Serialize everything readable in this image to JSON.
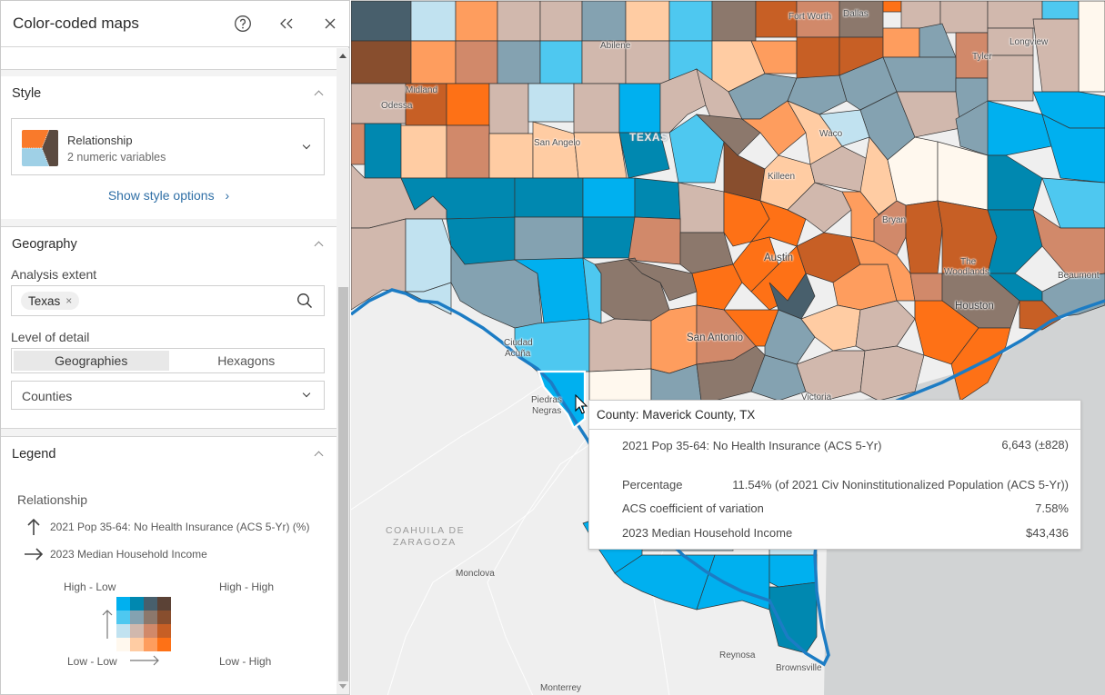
{
  "panel": {
    "title": "Color-coded maps",
    "help_icon": "help-circle-icon",
    "collapse_icon": "double-chevron-left-icon",
    "close_icon": "close-icon"
  },
  "style": {
    "title": "Style",
    "card_name": "Relationship",
    "card_sub": "2 numeric variables",
    "icon_colors": [
      "#f97a2b",
      "#5b4a40",
      "#9fd0e6"
    ],
    "show_options": "Show style options",
    "show_options_arrow": "›"
  },
  "geography": {
    "title": "Geography",
    "extent_label": "Analysis extent",
    "extent_chip": "Texas",
    "chip_remove": "×",
    "detail_label": "Level of detail",
    "segments": [
      "Geographies",
      "Hexagons"
    ],
    "active_segment": "Geographies",
    "level_select": "Counties"
  },
  "legend": {
    "title": "Legend",
    "heading": "Relationship",
    "var_vertical": "2021 Pop 35-64: No Health Insurance (ACS 5-Yr) (%)",
    "var_horizontal": "2023 Median Household Income",
    "corner_tl": "High - Low",
    "corner_tr": "High - High",
    "corner_bl": "Low - Low",
    "corner_br": "Low - High",
    "grid_colors": [
      [
        "#00b0ef",
        "#0088b0",
        "#485f6c",
        "#5b4236"
      ],
      [
        "#4ec8f0",
        "#84a2b1",
        "#8c786c",
        "#884e2e"
      ],
      [
        "#c1e2f0",
        "#d1b8ad",
        "#d1896a",
        "#c75f25"
      ],
      [
        "#fff8ee",
        "#ffcca3",
        "#fe9d5e",
        "#fe7116"
      ]
    ]
  },
  "map": {
    "labels": {
      "abilene": "Abilene",
      "midland": "Midland",
      "odessa": "Odessa",
      "san_angelo": "San Angelo",
      "texas": "TEXAS",
      "fort_worth": "Fort Worth",
      "dallas": "Dallas",
      "longview": "Longview",
      "tyler": "Tyler",
      "waco": "Waco",
      "killeen": "Killeen",
      "bryan": "Bryan",
      "austin": "Austin",
      "the_woodlands_1": "The",
      "the_woodlands_2": "Woodlands",
      "beaumont": "Beaumont",
      "houston": "Houston",
      "san_antonio": "San Antonio",
      "ciudad_acuna_1": "Ciudad",
      "ciudad_acuna_2": "Acuña",
      "piedras_negras_1": "Piedras",
      "piedras_negras_2": "Negras",
      "victoria": "Victoria",
      "coahuila_1": "COAHUILA DE",
      "coahuila_2": "ZARAGOZA",
      "monclova": "Monclova",
      "reynosa": "Reynosa",
      "brownsville": "Brownsville",
      "monterrey": "Monterrey"
    }
  },
  "popup": {
    "title": "County: Maverick County, TX",
    "rows": [
      {
        "label": "2021 Pop 35-64: No Health Insurance (ACS 5-Yr)",
        "value": "6,643 (±828)"
      },
      {
        "label": "Percentage",
        "value": "11.54% (of 2021 Civ Noninstitutionalized Population (ACS 5-Yr))"
      },
      {
        "label": "ACS coefficient of variation",
        "value": "7.58%"
      },
      {
        "label": "2023 Median Household Income",
        "value": "$43,436"
      }
    ]
  }
}
